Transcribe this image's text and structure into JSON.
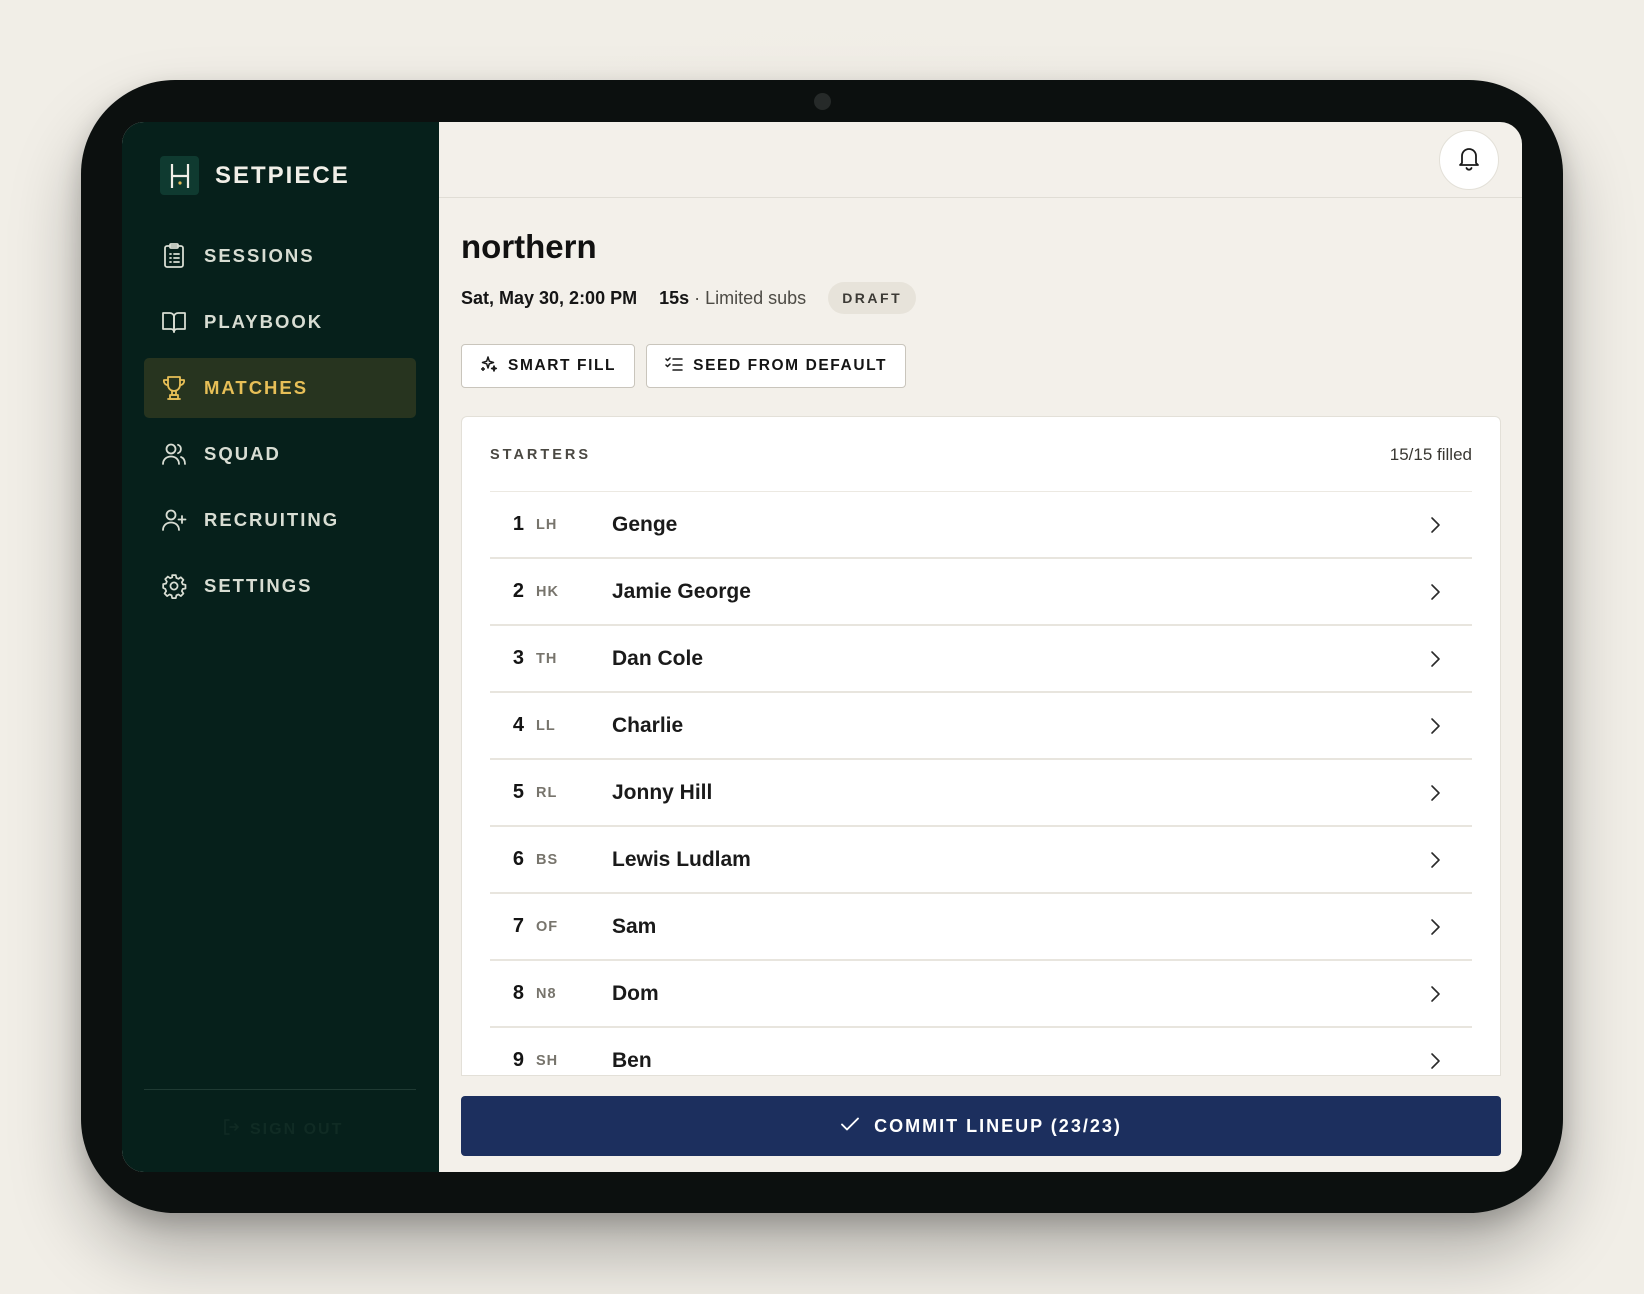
{
  "brand": {
    "name": "SETPIECE",
    "logo_icon": "goalposts-icon"
  },
  "nav": {
    "items": [
      {
        "label": "SESSIONS",
        "icon": "clipboard-list-icon",
        "active": false
      },
      {
        "label": "PLAYBOOK",
        "icon": "open-book-icon",
        "active": false
      },
      {
        "label": "MATCHES",
        "icon": "trophy-icon",
        "active": true
      },
      {
        "label": "SQUAD",
        "icon": "users-icon",
        "active": false
      },
      {
        "label": "RECRUITING",
        "icon": "user-plus-icon",
        "active": false
      },
      {
        "label": "SETTINGS",
        "icon": "gear-icon",
        "active": false
      }
    ],
    "signout_label": "SIGN OUT"
  },
  "match": {
    "title": "northern",
    "date": "Sat, May 30, 2:00 PM",
    "format": "15s",
    "subs": "· Limited subs",
    "status": "DRAFT"
  },
  "actions": {
    "smart_fill": "SMART FILL",
    "seed_default": "SEED FROM DEFAULT"
  },
  "starters": {
    "title": "STARTERS",
    "filled": "15/15 filled",
    "rows": [
      {
        "num": "1",
        "pos": "LH",
        "name": "Genge"
      },
      {
        "num": "2",
        "pos": "HK",
        "name": "Jamie George"
      },
      {
        "num": "3",
        "pos": "TH",
        "name": "Dan Cole"
      },
      {
        "num": "4",
        "pos": "LL",
        "name": "Charlie"
      },
      {
        "num": "5",
        "pos": "RL",
        "name": "Jonny Hill"
      },
      {
        "num": "6",
        "pos": "BS",
        "name": "Lewis Ludlam"
      },
      {
        "num": "7",
        "pos": "OF",
        "name": "Sam"
      },
      {
        "num": "8",
        "pos": "N8",
        "name": "Dom"
      },
      {
        "num": "9",
        "pos": "SH",
        "name": "Ben"
      }
    ]
  },
  "commit_label": "COMMIT LINEUP (23/23)",
  "colors": {
    "sidebar_bg": "#06201b",
    "active_accent": "#e7bf57",
    "primary_button": "#1c2f5e"
  }
}
